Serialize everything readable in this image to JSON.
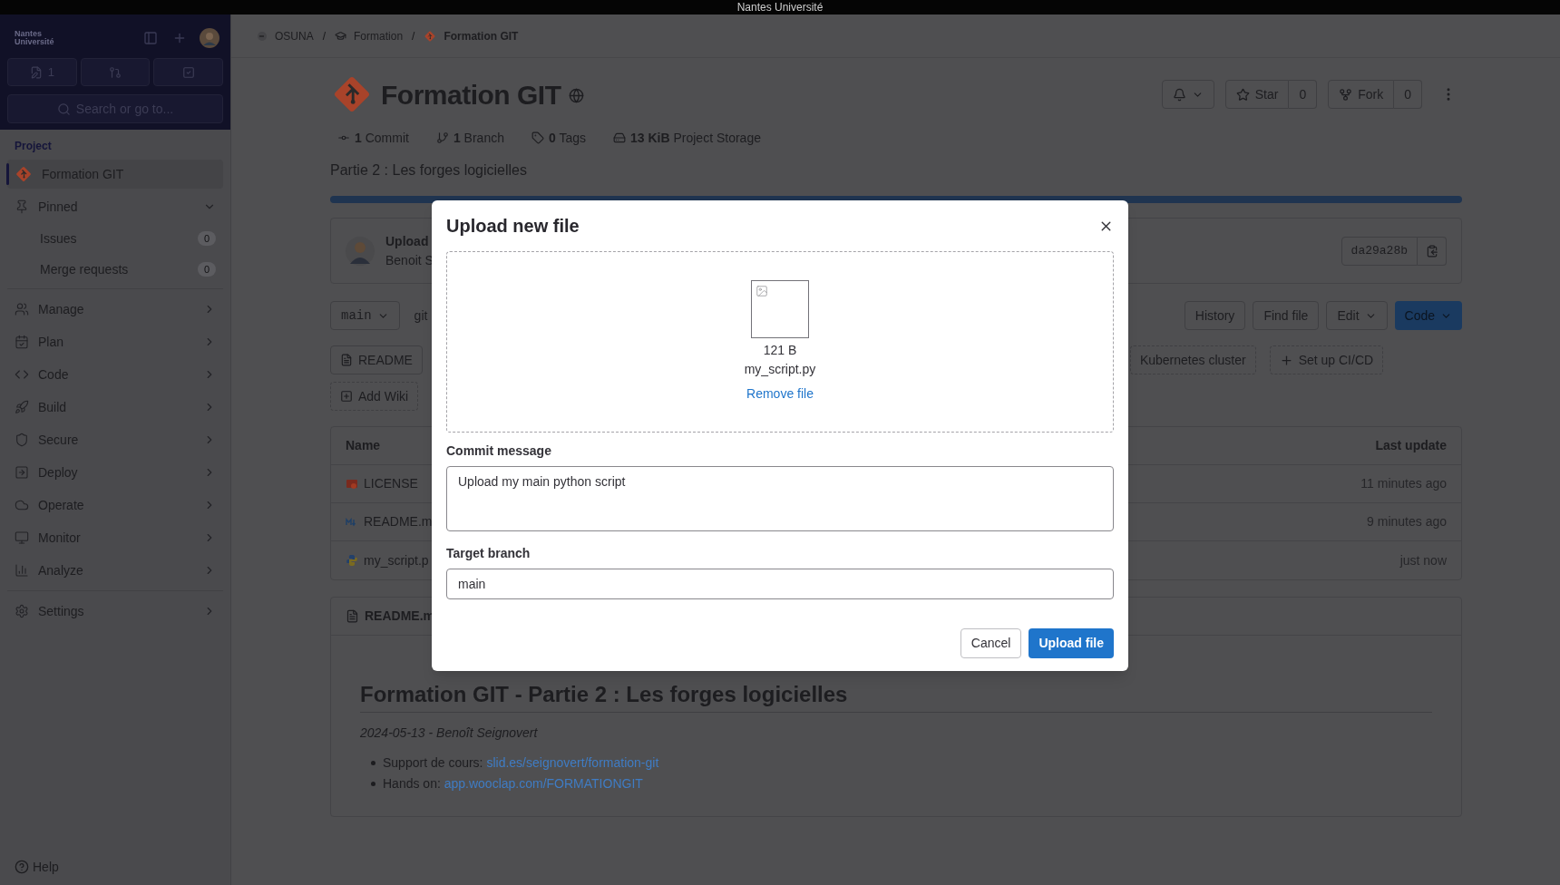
{
  "os_bar": {
    "title": "Nantes Université"
  },
  "sidebar": {
    "logo": "Nantes Université",
    "counters": [
      {
        "kind": "issues",
        "count": "1"
      },
      {
        "kind": "merge"
      },
      {
        "kind": "todo"
      }
    ],
    "search": {
      "placeholder": "Search or go to..."
    },
    "section": "Project",
    "groups": [
      {
        "items": [
          {
            "label": "Formation GIT",
            "kind": "project",
            "selected": true
          },
          {
            "label": "Pinned",
            "kind": "pinned",
            "expanded": true,
            "children": [
              {
                "label": "Issues",
                "count": "0"
              },
              {
                "label": "Merge requests",
                "count": "0"
              }
            ]
          }
        ]
      },
      {
        "items": [
          {
            "label": "Manage",
            "kind": "menu",
            "expanded": false
          },
          {
            "label": "Plan",
            "kind": "menu",
            "expanded": false
          },
          {
            "label": "Code",
            "kind": "menu",
            "expanded": false
          },
          {
            "label": "Build",
            "kind": "menu",
            "expanded": false
          },
          {
            "label": "Secure",
            "kind": "menu",
            "expanded": false
          },
          {
            "label": "Deploy",
            "kind": "menu",
            "expanded": false
          },
          {
            "label": "Operate",
            "kind": "menu",
            "expanded": false
          },
          {
            "label": "Monitor",
            "kind": "menu",
            "expanded": false
          },
          {
            "label": "Analyze",
            "kind": "menu",
            "expanded": false
          }
        ]
      },
      {
        "items": [
          {
            "label": "Settings",
            "kind": "menu",
            "expanded": false
          }
        ]
      }
    ],
    "help": "Help"
  },
  "breadcrumbs": [
    "OSUNA",
    "Formation",
    "Formation GIT"
  ],
  "breadcrumb_separator": "/",
  "project": {
    "title": "Formation GIT",
    "stats": [
      {
        "value": "1",
        "label": "Commit"
      },
      {
        "value": "1",
        "label": "Branch"
      },
      {
        "value": "0",
        "label": "Tags"
      },
      {
        "value": "13 KiB",
        "label": "Project Storage"
      }
    ],
    "description": "Partie 2 : Les forges logicielles",
    "star": {
      "label": "Star",
      "count": "0"
    },
    "fork": {
      "label": "Fork",
      "count": "0"
    }
  },
  "last_commit": {
    "title": "Upload",
    "author": "Benoit S",
    "sha": "da29a28b"
  },
  "repo_toolbar": {
    "branch": "main",
    "path": "git",
    "buttons": [
      {
        "label": "History",
        "kind": "plain"
      },
      {
        "label": "Find file",
        "kind": "plain"
      },
      {
        "label": "Edit",
        "kind": "dropdown"
      },
      {
        "label": "Code",
        "kind": "primary"
      }
    ]
  },
  "shortcuts": [
    {
      "label": "README",
      "kind": "file"
    },
    {
      "label": "Kubernetes cluster",
      "kind": "add"
    },
    {
      "label": "Set up CI/CD",
      "kind": "add"
    },
    {
      "label": "Add Wiki",
      "kind": "add"
    }
  ],
  "files": {
    "columns": [
      "Name",
      "Last update"
    ],
    "rows": [
      {
        "name": "LICENSE",
        "kind": "license",
        "updated": "11 minutes ago"
      },
      {
        "name": "README.m",
        "kind": "markdown",
        "updated": "9 minutes ago"
      },
      {
        "name": "my_script.p",
        "kind": "python",
        "updated": "just now"
      }
    ]
  },
  "readme": {
    "filename": "README.m",
    "heading": "Formation GIT - Partie 2 : Les forges logicielles",
    "byline": "2024-05-13 - Benoît Seignovert",
    "bullets": [
      {
        "text": "Support de cours:",
        "link": "slid.es/seignovert/formation-git"
      },
      {
        "text": "Hands on:",
        "link": "app.wooclap.com/FORMATIONGIT"
      }
    ]
  },
  "modal": {
    "title": "Upload new file",
    "file": {
      "size": "121 B",
      "name": "my_script.py"
    },
    "remove": "Remove file",
    "commit_label": "Commit message",
    "commit_value": "Upload my main python script",
    "branch_label": "Target branch",
    "branch_value": "main",
    "cancel": "Cancel",
    "submit": "Upload file"
  }
}
